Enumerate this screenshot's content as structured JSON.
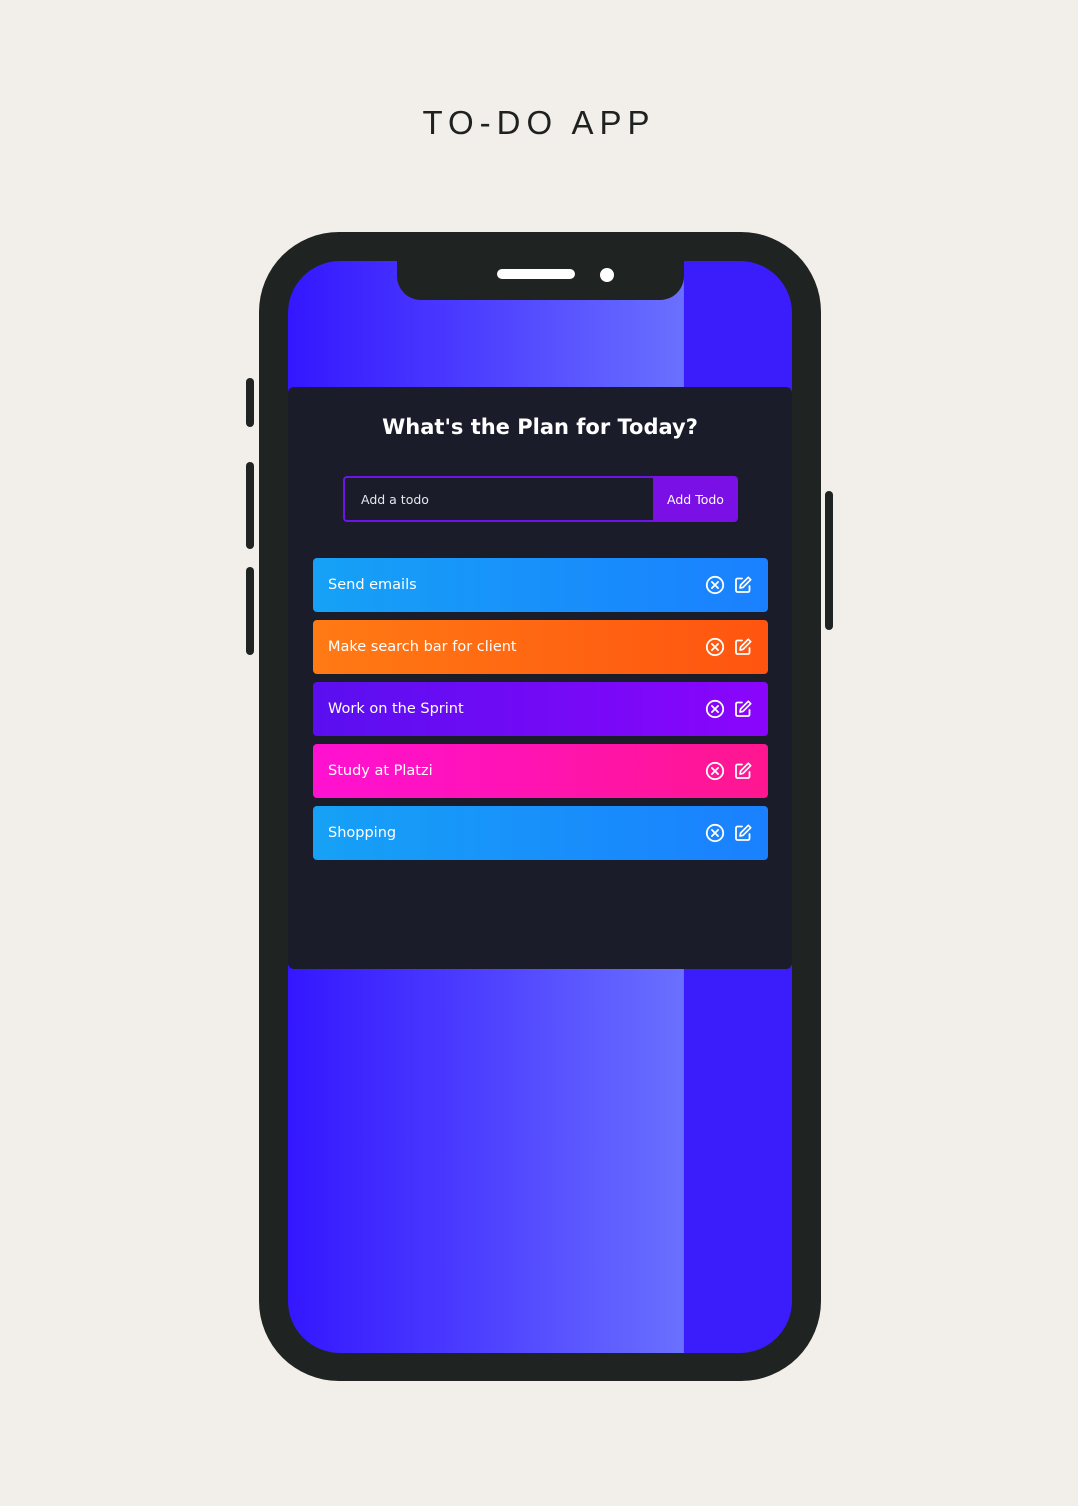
{
  "page": {
    "title": "TO-DO APP"
  },
  "app": {
    "heading": "What's the Plan for Today?",
    "input": {
      "placeholder": "Add a todo",
      "value": ""
    },
    "add_button_label": "Add Todo",
    "todos": [
      {
        "text": "Send emails",
        "color": "#1a8eff"
      },
      {
        "text": "Make search bar for client",
        "color": "#ff6512"
      },
      {
        "text": "Work on the Sprint",
        "color": "#7a09f7"
      },
      {
        "text": "Study at Platzi",
        "color": "#ff12b0"
      },
      {
        "text": "Shopping",
        "color": "#1a8eff"
      }
    ],
    "icons": {
      "delete": "close-circle-icon",
      "edit": "edit-icon"
    }
  },
  "colors": {
    "background": "#f2efea",
    "phone_frame": "#1f2321",
    "screen_gradient_start": "#3417ff",
    "app_panel": "#1a1c29",
    "accent": "#7a0fe6"
  }
}
